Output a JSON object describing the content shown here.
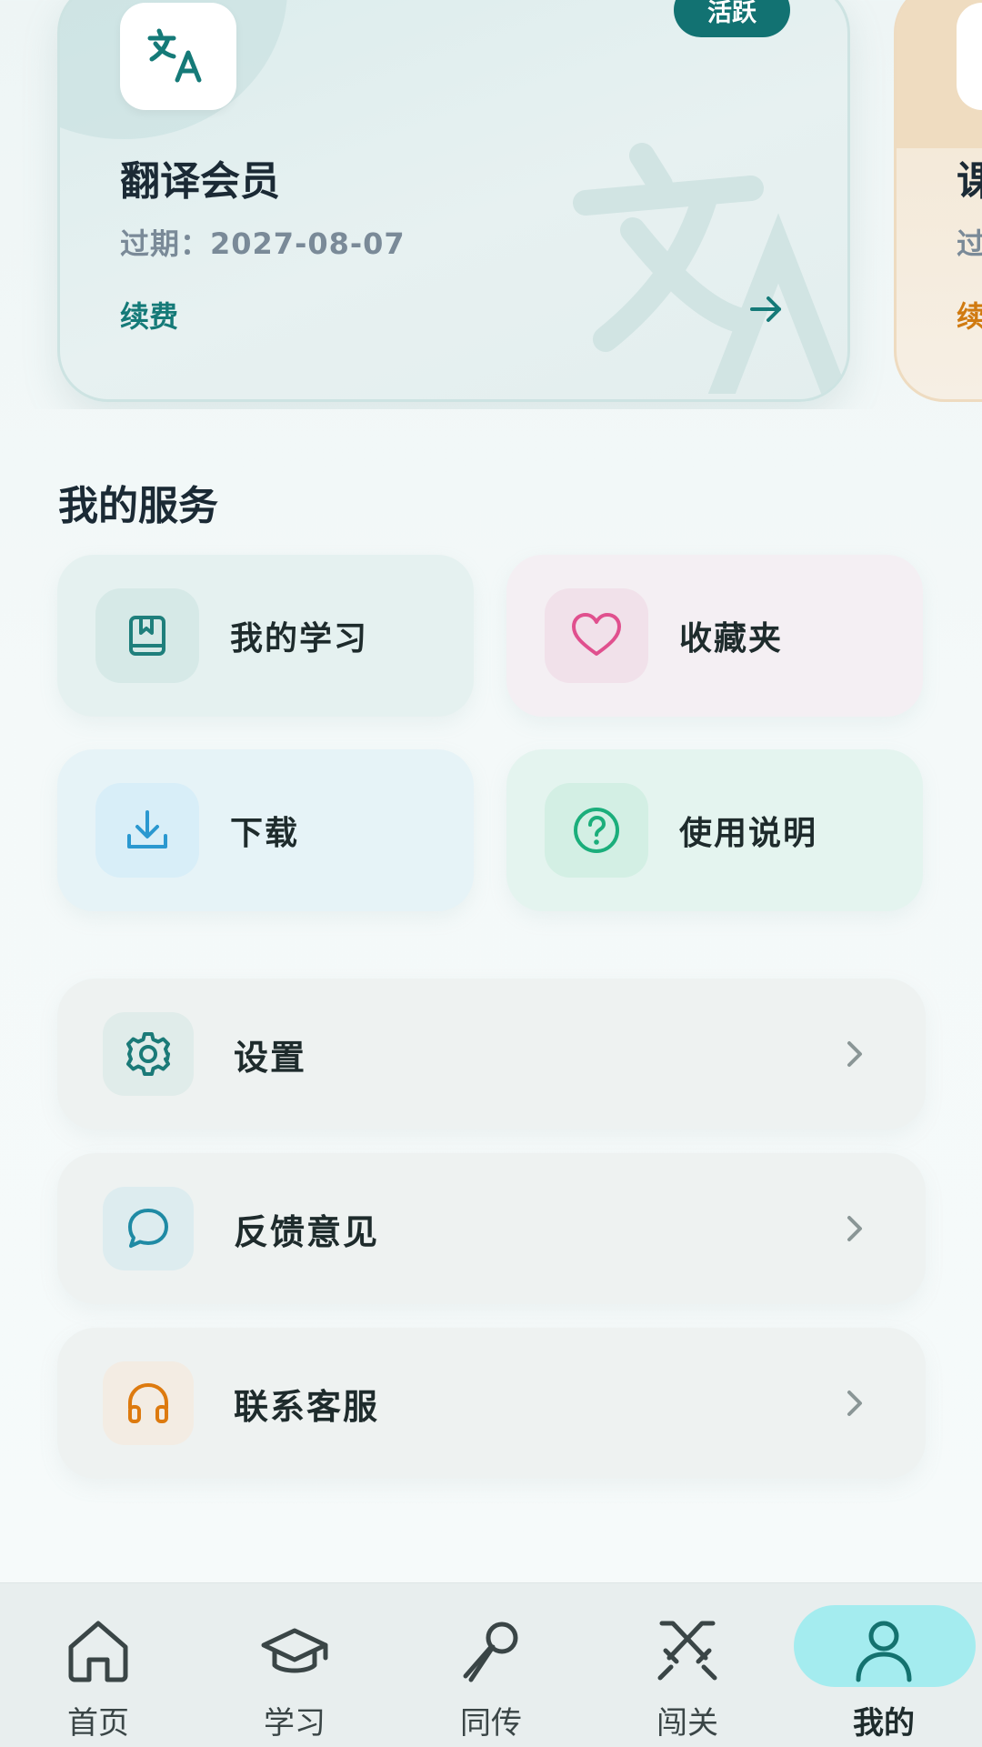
{
  "membership_cards": [
    {
      "title": "翻译会员",
      "expiry": "过期：2027-08-07",
      "status": "活跃",
      "action": "续费",
      "icon": "translate-icon",
      "accent": "#127272"
    },
    {
      "title": "课",
      "expiry": "过",
      "action": "续",
      "accent": "#d07a10"
    }
  ],
  "services": {
    "title": "我的服务",
    "tiles": [
      {
        "label": "我的学习",
        "icon": "book-icon",
        "color": "#1f7f7c",
        "bg": "#e5f1f0",
        "iconbg": "#d6e9e7"
      },
      {
        "label": "收藏夹",
        "icon": "heart-icon",
        "color": "#e0508e",
        "bg": "#f4eff3",
        "iconbg": "#f1e1ea"
      },
      {
        "label": "下载",
        "icon": "download-icon",
        "color": "#2a98d0",
        "bg": "#e6f3f7",
        "iconbg": "#d8eef8"
      },
      {
        "label": "使用说明",
        "icon": "help-circle-icon",
        "color": "#1bae7b",
        "bg": "#e4f4ef",
        "iconbg": "#d3efe4"
      }
    ]
  },
  "settings_list": [
    {
      "label": "设置",
      "icon": "gear-icon",
      "color": "#1b7a78",
      "iconbg": "#e0ecea"
    },
    {
      "label": "反馈意见",
      "icon": "chat-bubble-icon",
      "color": "#1f8aa4",
      "iconbg": "#ddecef"
    },
    {
      "label": "联系客服",
      "icon": "headphones-icon",
      "color": "#dd7a0f",
      "iconbg": "#f3ece3"
    }
  ],
  "tabbar": {
    "tabs": [
      {
        "label": "首页",
        "icon": "home-icon"
      },
      {
        "label": "学习",
        "icon": "graduation-cap-icon"
      },
      {
        "label": "同传",
        "icon": "microphone-icon"
      },
      {
        "label": "闯关",
        "icon": "crossed-swords-icon"
      },
      {
        "label": "我的",
        "icon": "user-icon"
      }
    ],
    "active": "我的",
    "active_color": "#a4ecef"
  }
}
